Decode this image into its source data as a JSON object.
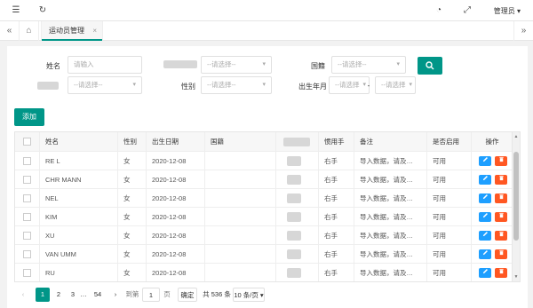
{
  "topbar": {
    "menu_icon": "menu-toggle-icon",
    "refresh_icon": "refresh-icon",
    "theme_icon": "theme-icon",
    "fullscreen_icon": "fullscreen-icon",
    "user_label": "管理员",
    "user_caret": "▾"
  },
  "tabs": {
    "left_nav": "«",
    "home_icon": "home-icon",
    "active_tab": "运动员管理",
    "close": "×",
    "right_nav": "»"
  },
  "filters": {
    "name_label": "姓名",
    "name_placeholder": "请输入",
    "select_placeholder": "--请选择--",
    "country_label": "国籍",
    "gender_label": "性别",
    "birth_label": "出生年月",
    "month_placeholder": "--请选择",
    "dash": "-"
  },
  "buttons": {
    "search_icon": "search-icon",
    "add_label": "添加"
  },
  "table": {
    "columns": [
      "姓名",
      "性别",
      "出生日期",
      "国籍",
      "",
      "惯用手",
      "备注",
      "是否启用",
      "操作"
    ],
    "rows": [
      {
        "name": "RE L",
        "gender": "女",
        "dob": "2020-12-08",
        "country": "",
        "hand": "右手",
        "note": "导入数据，请及…",
        "enabled": "可用"
      },
      {
        "name": "CHR MANN",
        "gender": "女",
        "dob": "2020-12-08",
        "country": "",
        "hand": "右手",
        "note": "导入数据，请及…",
        "enabled": "可用"
      },
      {
        "name": "NEL",
        "gender": "女",
        "dob": "2020-12-08",
        "country": "",
        "hand": "右手",
        "note": "导入数据，请及…",
        "enabled": "可用"
      },
      {
        "name": "KIM",
        "gender": "女",
        "dob": "2020-12-08",
        "country": "",
        "hand": "右手",
        "note": "导入数据，请及…",
        "enabled": "可用"
      },
      {
        "name": "XU",
        "gender": "女",
        "dob": "2020-12-08",
        "country": "",
        "hand": "右手",
        "note": "导入数据，请及…",
        "enabled": "可用"
      },
      {
        "name": "VAN UMM",
        "gender": "女",
        "dob": "2020-12-08",
        "country": "",
        "hand": "右手",
        "note": "导入数据，请及…",
        "enabled": "可用"
      },
      {
        "name": "RU",
        "gender": "女",
        "dob": "2020-12-08",
        "country": "",
        "hand": "右手",
        "note": "导入数据，请及…",
        "enabled": "可用"
      }
    ],
    "edit_icon": "edit-icon",
    "delete_icon": "trash-icon"
  },
  "pager": {
    "prev": "‹",
    "pages": [
      "1",
      "2",
      "3",
      "…",
      "54"
    ],
    "next": "›",
    "goto_label": "到第",
    "goto_value": "1",
    "page_unit": "页",
    "confirm_label": "确定",
    "total_label": "共 536 条",
    "page_size": "10 条/页",
    "page_size_caret": "▾"
  },
  "colors": {
    "primary": "#009688",
    "edit": "#1e9fff",
    "delete": "#ff5722"
  }
}
